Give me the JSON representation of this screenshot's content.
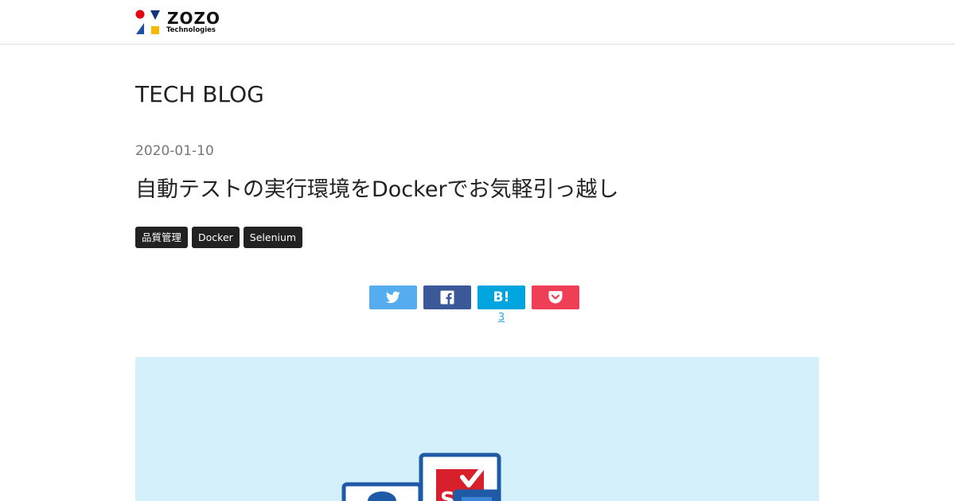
{
  "header": {
    "logo": {
      "wordmark": "ZOZO",
      "subtitle": "Technologies",
      "colors": {
        "red": "#e60012",
        "navy": "#12327a",
        "blue": "#1e62c7",
        "yellow": "#f5b800"
      }
    }
  },
  "blog_title": "TECH BLOG",
  "post": {
    "date": "2020-01-10",
    "title": "自動テストの実行環境をDockerでお気軽引っ越し",
    "tags": [
      "品質管理",
      "Docker",
      "Selenium"
    ]
  },
  "share": {
    "twitter": {
      "icon": "twitter-bird-icon",
      "color": "#55acee"
    },
    "facebook": {
      "icon": "facebook-f-icon",
      "color": "#3b5998"
    },
    "hatena": {
      "label": "B!",
      "count": "3",
      "color": "#00a4de"
    },
    "pocket": {
      "icon": "pocket-icon",
      "color": "#ef3f56"
    }
  },
  "eyecatch": {
    "background": "#d4f1fb",
    "icon": "selenium-docker-illustration"
  }
}
